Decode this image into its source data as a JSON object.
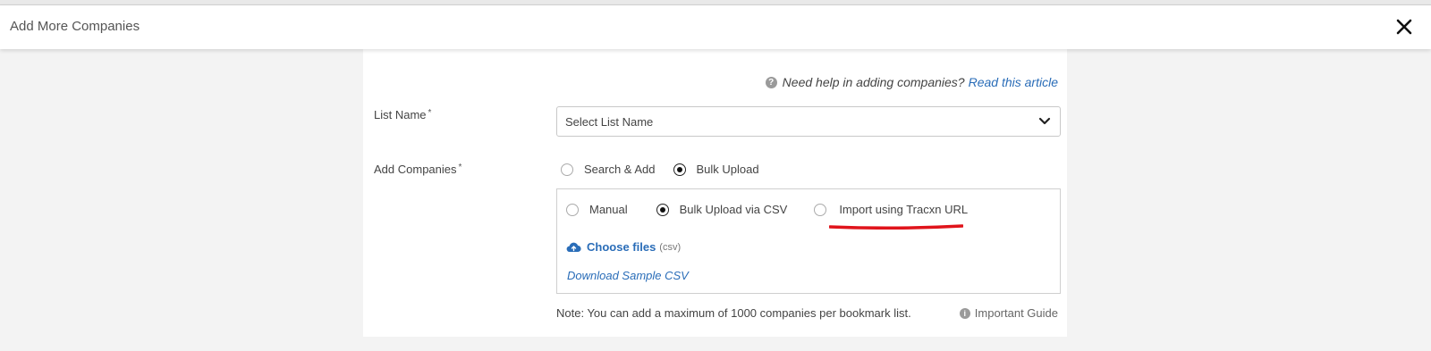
{
  "header": {
    "title": "Add More Companies"
  },
  "help": {
    "icon": "help-circle-icon",
    "text": "Need help in adding companies?",
    "link": "Read this article"
  },
  "list_name": {
    "label": "List Name",
    "required": "*",
    "placeholder": "Select List Name"
  },
  "add_companies": {
    "label": "Add Companies",
    "required": "*",
    "mode_options": [
      {
        "label": "Search & Add",
        "checked": false
      },
      {
        "label": "Bulk Upload",
        "checked": true
      }
    ],
    "bulk_options": [
      {
        "label": "Manual",
        "checked": false
      },
      {
        "label": "Bulk Upload via CSV",
        "checked": true
      },
      {
        "label": "Import using Tracxn URL",
        "checked": false
      }
    ],
    "choose_files": "Choose files",
    "file_hint": "(csv)",
    "download_sample": "Download Sample CSV"
  },
  "note": "Note: You can add a maximum of 1000 companies per bookmark list.",
  "guide": "Important Guide",
  "colors": {
    "link": "#2a6db8",
    "annotation_red": "#e0141b"
  }
}
